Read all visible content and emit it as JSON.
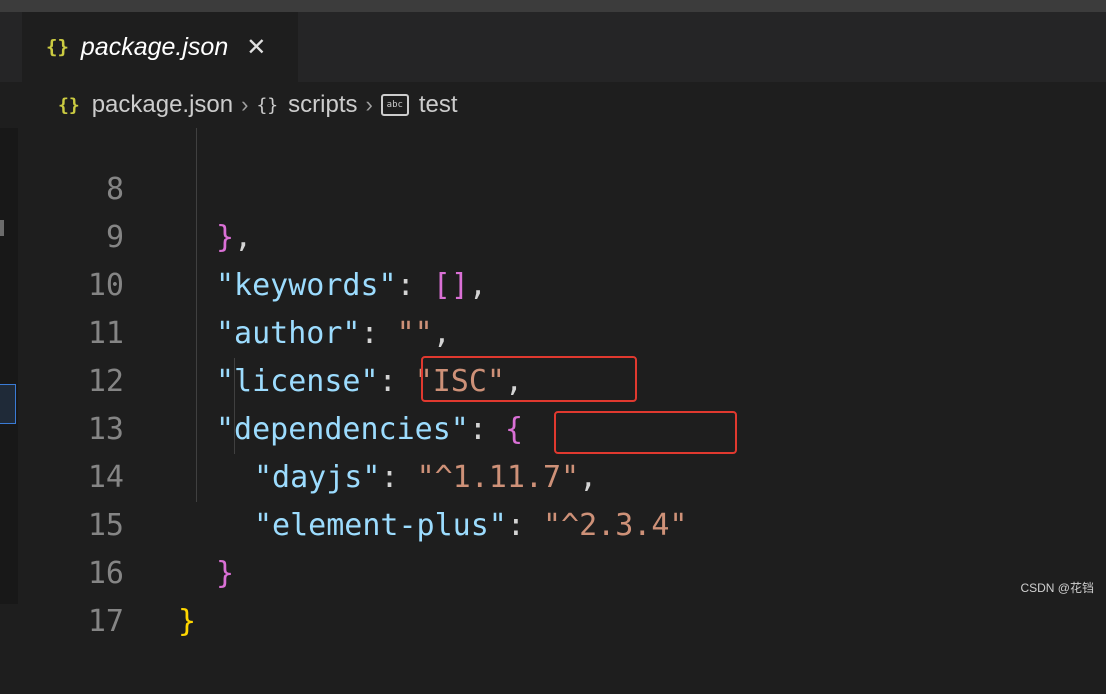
{
  "tab": {
    "icon": "{}",
    "title": "package.json",
    "close": "✕"
  },
  "breadcrumb": {
    "file_icon": "{}",
    "file": "package.json",
    "sep1": "›",
    "scripts_icon": "{}",
    "scripts": "scripts",
    "sep2": "›",
    "test_icon": "abc",
    "test": "test"
  },
  "lines": [
    {
      "n": "8"
    },
    {
      "n": "9"
    },
    {
      "n": "10"
    },
    {
      "n": "11"
    },
    {
      "n": "12"
    },
    {
      "n": "13"
    },
    {
      "n": "14"
    },
    {
      "n": "15"
    },
    {
      "n": "16"
    },
    {
      "n": "17"
    }
  ],
  "code": {
    "l8": {
      "brace": "}",
      "comma": ","
    },
    "l9": {
      "key": "\"keywords\"",
      "colon": ": ",
      "open": "[",
      "close": "]",
      "comma": ","
    },
    "l10": {
      "key": "\"author\"",
      "colon": ": ",
      "val": "\"\"",
      "comma": ","
    },
    "l11": {
      "key": "\"license\"",
      "colon": ": ",
      "val": "\"ISC\"",
      "comma": ","
    },
    "l12": {
      "key": "\"dependencies\"",
      "colon": ": ",
      "brace": "{"
    },
    "l13": {
      "key": "\"dayjs\"",
      "colon": ": ",
      "val": "\"^1.11.7\"",
      "comma": ","
    },
    "l14": {
      "key": "\"element-plus\"",
      "colon": ": ",
      "val": "\"^2.3.4\""
    },
    "l15": {
      "brace": "}"
    },
    "l16": {
      "brace": "}"
    },
    "l17": {}
  },
  "watermark": "CSDN @花铛",
  "colors": {
    "highlight_box": "#e0392f",
    "string": "#ce9178",
    "key": "#9cdcfe"
  }
}
